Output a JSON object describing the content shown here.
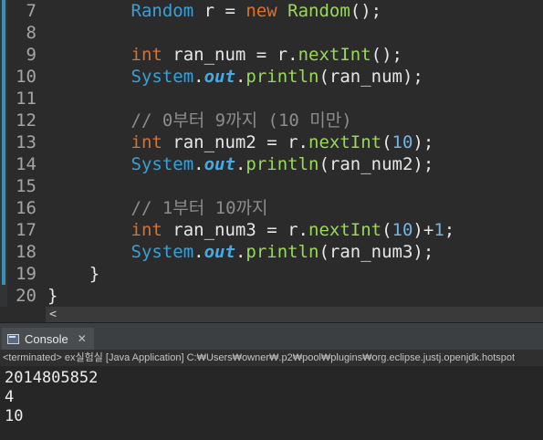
{
  "editor": {
    "lines": [
      {
        "no": "7",
        "tokens": [
          [
            "        ",
            ""
          ],
          [
            "Random",
            "cl"
          ],
          [
            " r = ",
            ""
          ],
          [
            "new",
            "kw"
          ],
          [
            " ",
            ""
          ],
          [
            "Random",
            "ty"
          ],
          [
            "();",
            ""
          ]
        ]
      },
      {
        "no": "8",
        "tokens": []
      },
      {
        "no": "9",
        "tokens": [
          [
            "        ",
            ""
          ],
          [
            "int",
            "kw"
          ],
          [
            " ran_num = r.",
            ""
          ],
          [
            "nextInt",
            "mt"
          ],
          [
            "();",
            ""
          ]
        ]
      },
      {
        "no": "10",
        "tokens": [
          [
            "        ",
            ""
          ],
          [
            "System",
            "cl"
          ],
          [
            ".",
            ""
          ],
          [
            "out",
            "fld"
          ],
          [
            ".",
            ""
          ],
          [
            "println",
            "mt"
          ],
          [
            "(ran_num);",
            ""
          ]
        ]
      },
      {
        "no": "11",
        "tokens": []
      },
      {
        "no": "12",
        "tokens": [
          [
            "        ",
            ""
          ],
          [
            "// 0부터 9까지 (10 미만)",
            "cm"
          ]
        ]
      },
      {
        "no": "13",
        "tokens": [
          [
            "        ",
            ""
          ],
          [
            "int",
            "kw"
          ],
          [
            " ran_num2 = r.",
            ""
          ],
          [
            "nextInt",
            "mt"
          ],
          [
            "(",
            ""
          ],
          [
            "10",
            "num"
          ],
          [
            ");",
            ""
          ]
        ]
      },
      {
        "no": "14",
        "tokens": [
          [
            "        ",
            ""
          ],
          [
            "System",
            "cl"
          ],
          [
            ".",
            ""
          ],
          [
            "out",
            "fld"
          ],
          [
            ".",
            ""
          ],
          [
            "println",
            "mt"
          ],
          [
            "(ran_num2);",
            ""
          ]
        ]
      },
      {
        "no": "15",
        "tokens": []
      },
      {
        "no": "16",
        "tokens": [
          [
            "        ",
            ""
          ],
          [
            "// 1부터 10까지",
            "cm"
          ]
        ]
      },
      {
        "no": "17",
        "tokens": [
          [
            "        ",
            ""
          ],
          [
            "int",
            "kw"
          ],
          [
            " ran_num3 = r.",
            ""
          ],
          [
            "nextInt",
            "mt"
          ],
          [
            "(",
            ""
          ],
          [
            "10",
            "num"
          ],
          [
            ")+",
            ""
          ],
          [
            "1",
            "num"
          ],
          [
            ";",
            ""
          ]
        ]
      },
      {
        "no": "18",
        "tokens": [
          [
            "        ",
            ""
          ],
          [
            "System",
            "cl"
          ],
          [
            ".",
            ""
          ],
          [
            "out",
            "fld"
          ],
          [
            ".",
            ""
          ],
          [
            "println",
            "mt"
          ],
          [
            "(ran_num3);",
            ""
          ]
        ]
      },
      {
        "no": "19",
        "tokens": [
          [
            "    }",
            ""
          ]
        ]
      },
      {
        "no": "20",
        "tokens": [
          [
            "}",
            ""
          ]
        ]
      }
    ],
    "scroll_left_glyph": "<"
  },
  "console": {
    "tab_label": "Console",
    "close_glyph": "✕",
    "status": "<terminated> ex실험실 [Java Application] C:₩Users₩owner₩.p2₩pool₩plugins₩org.eclipse.justj.openjdk.hotspot",
    "output": [
      "2014805852",
      "4",
      "10"
    ]
  },
  "colors": {
    "editor_bg": "#2b2b2b",
    "keyword": "#d7732f",
    "type": "#9bd75a",
    "class": "#3c9fd6",
    "comment": "#8c8c8c"
  }
}
